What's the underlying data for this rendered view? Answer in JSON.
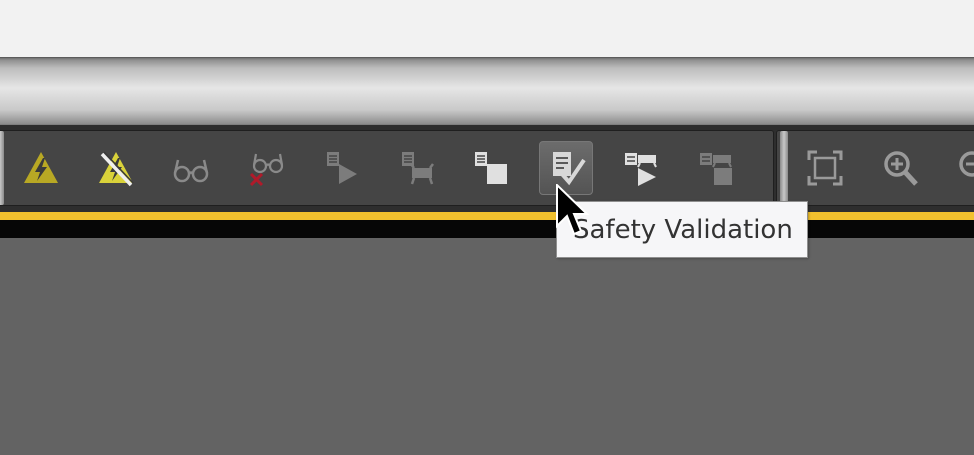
{
  "toolbar": {
    "buttons": [
      {
        "name": "high-voltage-warning",
        "icon": "lightning-triangle-icon",
        "state": "enabled"
      },
      {
        "name": "hide-warnings",
        "icon": "lightning-triangle-slash-icon",
        "state": "enabled"
      },
      {
        "name": "glasses",
        "icon": "glasses-icon",
        "state": "disabled"
      },
      {
        "name": "glasses-remove",
        "icon": "glasses-x-icon",
        "state": "disabled"
      },
      {
        "name": "run-list",
        "icon": "list-play-icon",
        "state": "disabled"
      },
      {
        "name": "robot-list",
        "icon": "list-robot-icon",
        "state": "disabled"
      },
      {
        "name": "list-stop",
        "icon": "list-square-icon",
        "state": "enabled"
      },
      {
        "name": "safety-validation",
        "icon": "list-check-icon",
        "state": "active"
      },
      {
        "name": "film-play",
        "icon": "film-play-icon",
        "state": "enabled"
      },
      {
        "name": "film-stop",
        "icon": "film-square-icon",
        "state": "disabled"
      }
    ],
    "view_buttons": [
      {
        "name": "fit-view",
        "icon": "fit-frame-icon"
      },
      {
        "name": "zoom-in",
        "icon": "zoom-in-icon"
      },
      {
        "name": "zoom-out",
        "icon": "zoom-out-icon"
      }
    ]
  },
  "tooltip": {
    "text": "Safety Validation"
  },
  "colors": {
    "accent_yellow": "#f2c12e",
    "toolbar_bg": "#454545",
    "viewport_bg": "#636363",
    "warning_yellow": "#c9b81e",
    "error_red": "#c0152a"
  }
}
